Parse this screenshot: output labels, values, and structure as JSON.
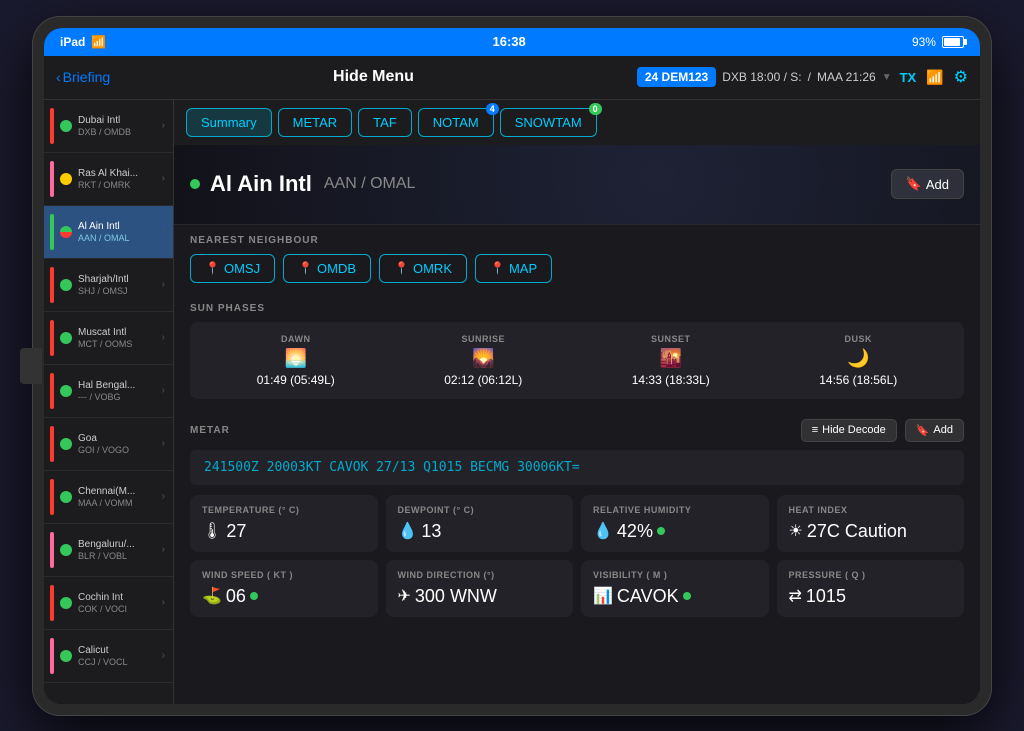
{
  "status_bar": {
    "device": "iPad",
    "wifi": "wifi",
    "time": "16:38",
    "battery_pct": "93%"
  },
  "nav_bar": {
    "back_label": "Briefing",
    "title": "Hide Menu",
    "flight_badge": "24 DEM123",
    "departure": "DXB",
    "departure_time": "18:00 / S:",
    "arrival": "MAA",
    "arrival_time": "21:26",
    "tx_label": "TX",
    "settings_icon": "gear-icon"
  },
  "tabs": [
    {
      "label": "Summary",
      "active": true,
      "badge": null
    },
    {
      "label": "METAR",
      "active": false,
      "badge": null
    },
    {
      "label": "TAF",
      "active": false,
      "badge": null
    },
    {
      "label": "NOTAM",
      "active": false,
      "badge": "4"
    },
    {
      "label": "SNOWTAM",
      "active": false,
      "badge": "0"
    }
  ],
  "sidebar": {
    "items": [
      {
        "name": "Dubai Intl",
        "code": "DXB / OMDB",
        "indicator": "red",
        "dot": "green",
        "active": false
      },
      {
        "name": "Ras Al Khai...",
        "code": "RKT / OMRK",
        "indicator": "pink",
        "dot": "yellow",
        "active": false
      },
      {
        "name": "Al Ain Intl",
        "code": "AAN / OMAL",
        "indicator": "green",
        "dot": "half",
        "active": true
      },
      {
        "name": "Sharjah/Intl",
        "code": "SHJ / OMSJ",
        "indicator": "red",
        "dot": "green",
        "active": false
      },
      {
        "name": "Muscat Intl",
        "code": "MCT / OOMS",
        "indicator": "red",
        "dot": "green",
        "active": false
      },
      {
        "name": "Hal Bengal...",
        "code": "--- / VOBG",
        "indicator": "red",
        "dot": "green",
        "active": false
      },
      {
        "name": "Goa",
        "code": "GOI / VOGO",
        "indicator": "red",
        "dot": "green",
        "active": false
      },
      {
        "name": "Chennai(M...",
        "code": "MAA / VOMM",
        "indicator": "red",
        "dot": "green",
        "active": false
      },
      {
        "name": "Bengaluru/...",
        "code": "BLR / VOBL",
        "indicator": "pink",
        "dot": "green",
        "active": false
      },
      {
        "name": "Cochin Int",
        "code": "COK / VOCI",
        "indicator": "red",
        "dot": "green",
        "active": false
      },
      {
        "name": "Calicut",
        "code": "CCJ / VOCL",
        "indicator": "pink",
        "dot": "green",
        "active": false
      }
    ]
  },
  "airport_header": {
    "name": "Al Ain Intl",
    "code": "AAN / OMAL",
    "status": "green",
    "add_label": "Add"
  },
  "nearest_neighbour": {
    "section_title": "NEAREST NEIGHBOUR",
    "buttons": [
      "OMSJ",
      "OMDB",
      "OMRK",
      "MAP"
    ]
  },
  "sun_phases": {
    "section_title": "SUN PHASES",
    "phases": [
      {
        "label": "DAWN",
        "icon": "🌅",
        "time": "01:49 (05:49L)"
      },
      {
        "label": "SUNRISE",
        "icon": "🌄",
        "time": "02:12 (06:12L)"
      },
      {
        "label": "SUNSET",
        "icon": "🌇",
        "time": "14:33 (18:33L)"
      },
      {
        "label": "DUSK",
        "icon": "🌙",
        "time": "14:56 (18:56L)"
      }
    ]
  },
  "metar": {
    "section_title": "METAR",
    "hide_decode_label": "Hide Decode",
    "add_label": "Add",
    "raw": "241500Z 20003KT CAVOK 27/13 Q1015 BECMG 30006KT="
  },
  "weather_data": {
    "items": [
      {
        "label": "TEMPERATURE (° C)",
        "icon": "🌡",
        "value": "27"
      },
      {
        "label": "DEWPOINT (° C)",
        "icon": "💧",
        "value": "13"
      },
      {
        "label": "RELATIVE HUMIDITY",
        "icon": "💧",
        "value": "42%",
        "status_dot": true
      },
      {
        "label": "HEAT INDEX",
        "icon": "☀",
        "value": "27C Caution"
      }
    ],
    "items2": [
      {
        "label": "WIND SPEED ( KT )",
        "icon": "⛳",
        "value": "06",
        "status_dot": true
      },
      {
        "label": "WIND DIRECTION (°)",
        "icon": "✈",
        "value": "300 WNW"
      },
      {
        "label": "VISIBILITY ( M )",
        "icon": "📊",
        "value": "CAVOK",
        "status_dot": true
      },
      {
        "label": "PRESSURE ( Q )",
        "icon": "⇄",
        "value": "1015"
      }
    ]
  }
}
